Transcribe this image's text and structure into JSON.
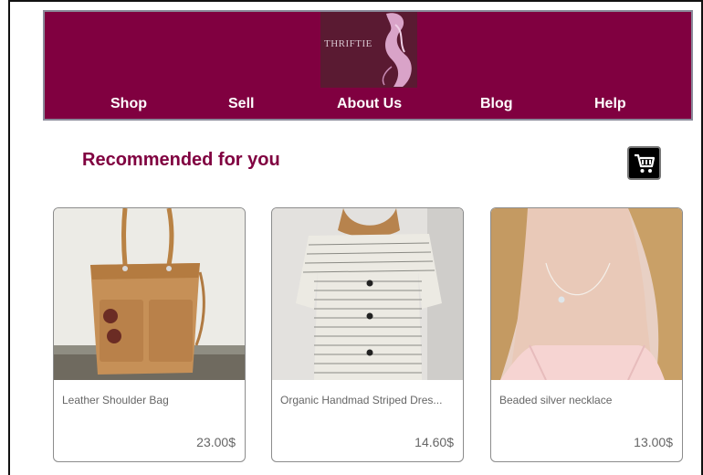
{
  "header": {
    "logo_text": "THRIFTIE",
    "nav": [
      "Shop",
      "Sell",
      "About Us",
      "Blog",
      "Help"
    ]
  },
  "main": {
    "section_title": "Recommended for you",
    "cart_icon": "shopping-cart-icon",
    "products": [
      {
        "name": "Leather Shoulder Bag",
        "price": "23.00$"
      },
      {
        "name": "Organic Handmad Striped Dres...",
        "price": "14.60$"
      },
      {
        "name": "Beaded silver necklace",
        "price": "13.00$"
      }
    ]
  },
  "colors": {
    "brand": "#800040",
    "logo_bg": "#5a1a32",
    "card_border": "#8c8c8c",
    "text_muted": "#666666"
  }
}
